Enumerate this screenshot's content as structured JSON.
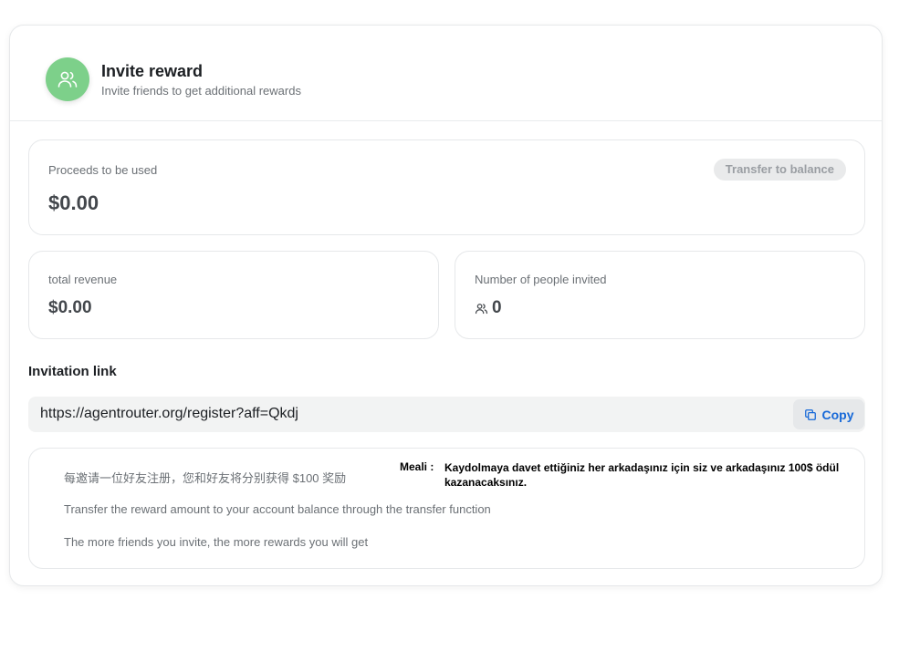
{
  "header": {
    "title": "Invite reward",
    "subtitle": "Invite friends to get additional rewards",
    "icon": "users-icon",
    "accent_color": "#7dd08a"
  },
  "proceeds": {
    "label": "Proceeds to be used",
    "value": "$0.00",
    "transfer_button": "Transfer to balance"
  },
  "revenue": {
    "label": "total revenue",
    "value": "$0.00"
  },
  "invited": {
    "label": "Number of people invited",
    "value": "0",
    "icon": "users-icon"
  },
  "invitation": {
    "title": "Invitation link",
    "link": "https://agentrouter.org/register?aff=Qkdj",
    "copy_label": "Copy",
    "copy_color": "#1769d8"
  },
  "info": {
    "lines": [
      "每邀请一位好友注册，您和好友将分别获得 $100 奖励",
      "Transfer the reward amount to your account balance through the transfer function",
      "The more friends you invite, the more rewards you will get"
    ],
    "note_label": "Meali :",
    "note_text": "Kaydolmaya davet ettiğiniz her arkadaşınız için siz ve arkadaşınız 100$ ödül kazanacaksınız."
  }
}
